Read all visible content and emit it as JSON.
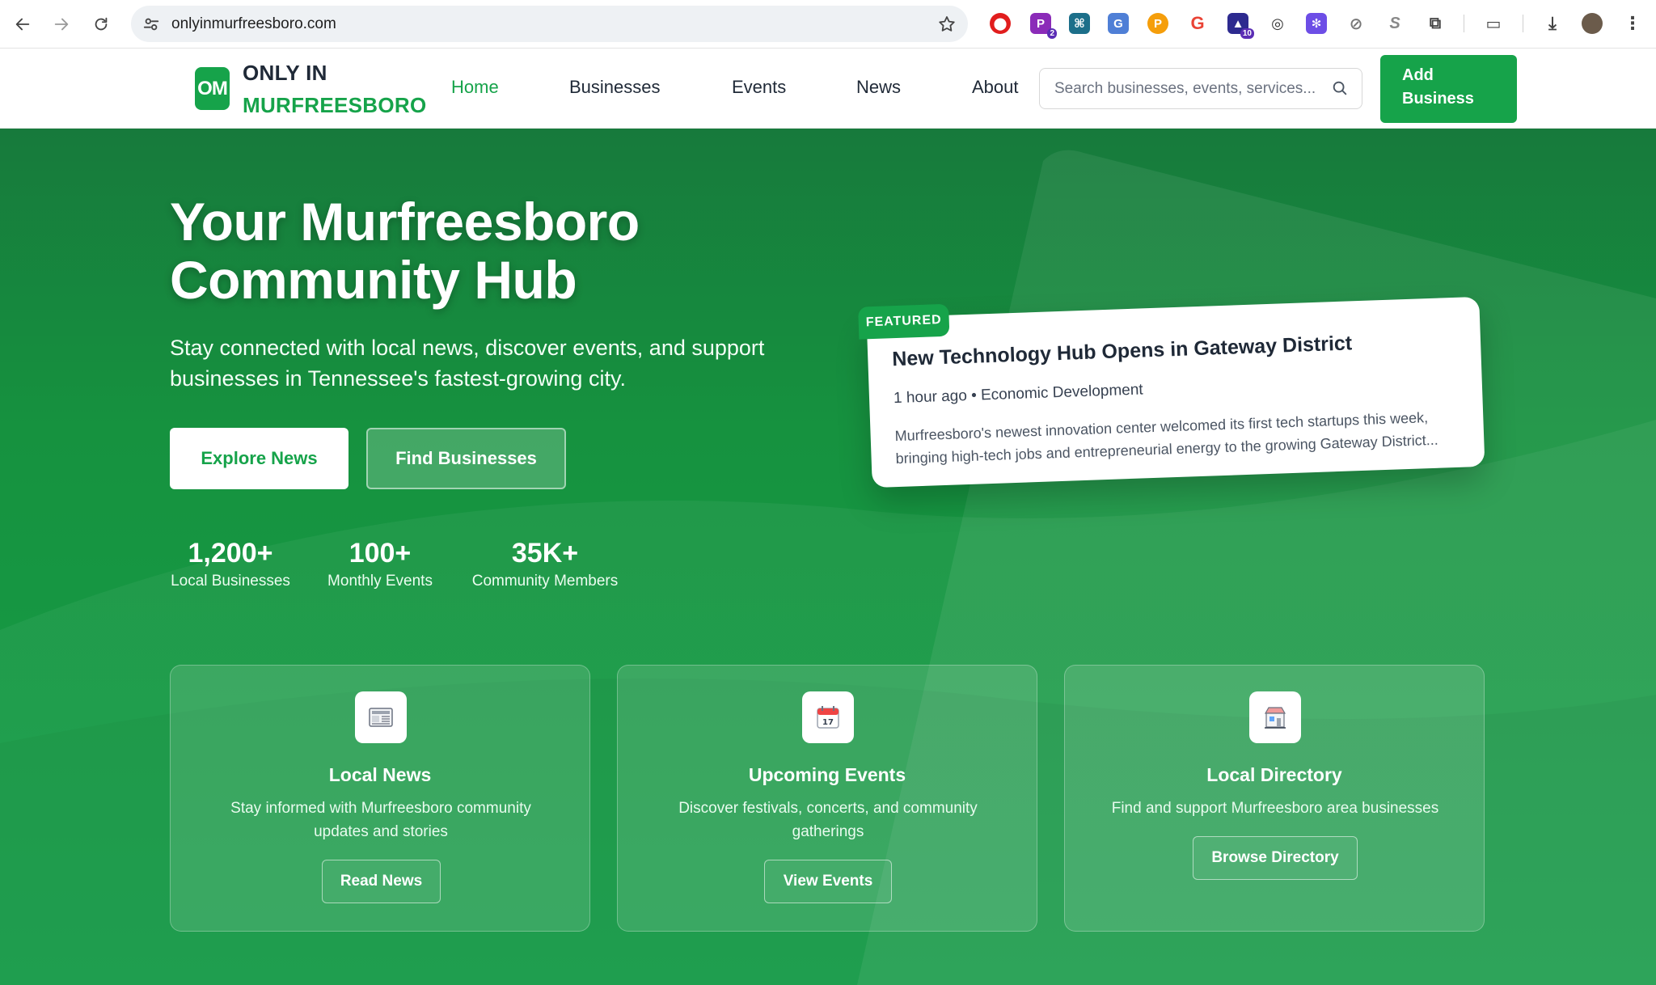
{
  "browser": {
    "url": "onlyinmurfreesboro.com",
    "extension_badges": {
      "ext2": "2",
      "ext8": "10"
    }
  },
  "site": {
    "logo_badge": "OM",
    "logo_line1": "ONLY IN",
    "logo_line2": "MURFREESBORO",
    "nav": [
      {
        "label": "Home",
        "active": true
      },
      {
        "label": "Businesses"
      },
      {
        "label": "Events"
      },
      {
        "label": "News"
      },
      {
        "label": "About"
      }
    ],
    "search_placeholder": "Search businesses, events, services...",
    "add_business_line1": "Add",
    "add_business_line2": "Business",
    "accent_color": "#16a34a"
  },
  "hero": {
    "title_line1": "Your Murfreesboro",
    "title_line2": "Community Hub",
    "subtitle_line1": "Stay connected with local news, discover events, and support",
    "subtitle_line2": "businesses in Tennessee's fastest-growing city.",
    "btn_explore": "Explore News",
    "btn_find": "Find Businesses",
    "stats": [
      {
        "value": "1,200+",
        "label": "Local Businesses"
      },
      {
        "value": "100+",
        "label": "Monthly Events"
      },
      {
        "value": "35K+",
        "label": "Community Members"
      }
    ]
  },
  "featured": {
    "tag": "FEATURED",
    "title": "New Technology Hub Opens in Gateway District",
    "time": "1 hour ago",
    "category": "Economic Development",
    "excerpt": "Murfreesboro's newest innovation center welcomed its first tech startups this week, bringing high-tech jobs and entrepreneurial energy to the growing Gateway District..."
  },
  "cards": [
    {
      "icon": "newspaper-icon",
      "title": "Local News",
      "description": "Stay informed with Murfreesboro community updates and stories",
      "button": "Read News"
    },
    {
      "icon": "calendar-icon",
      "title": "Upcoming Events",
      "description": "Discover festivals, concerts, and community gatherings",
      "button": "View Events"
    },
    {
      "icon": "storefront-icon",
      "title": "Local Directory",
      "description": "Find and support Murfreesboro area businesses",
      "button": "Browse Directory"
    }
  ]
}
